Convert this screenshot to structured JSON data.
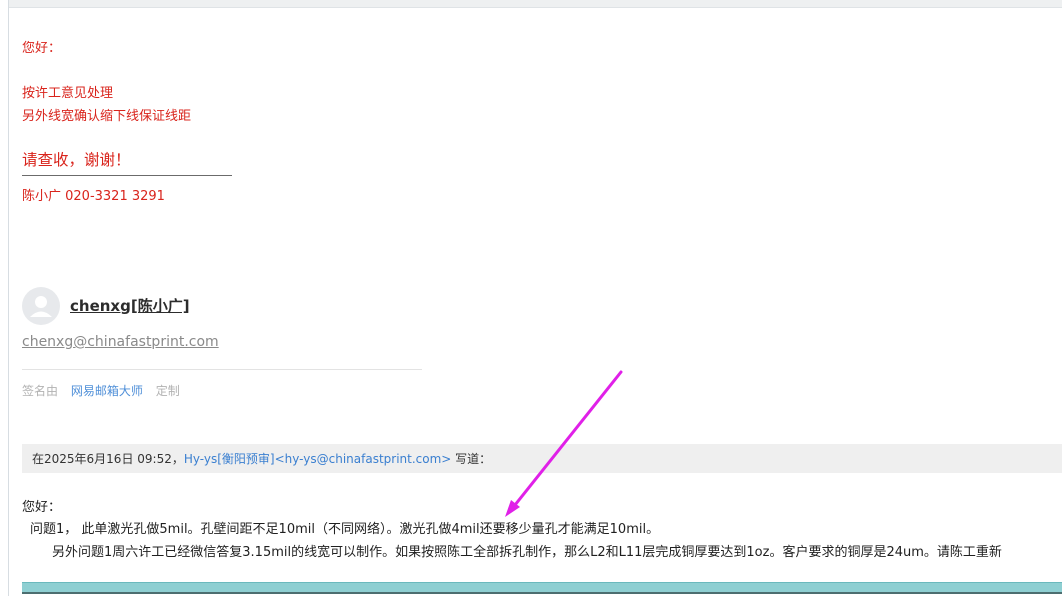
{
  "reply": {
    "greeting": "您好：",
    "line1": "按许工意见处理",
    "line2": "另外线宽确认缩下线保证线距",
    "thanks": "请查收，谢谢！",
    "contact": "陈小广 020-3321 3291",
    "text_color": "#d9241c"
  },
  "signature_card": {
    "avatar_icon": "user-avatar-icon",
    "name": "chenxg[陈小广]",
    "email": "chenxg@chinafastprint.com",
    "signed_by_label": "签名由",
    "tool_link": "网易邮箱大师",
    "customize_link": "定制"
  },
  "quote_header": {
    "prefix": "在2025年6月16日 09:52，",
    "sender": "Hy-ys[衡阳预审]<hy-ys@chinafastprint.com>",
    "suffix": " 写道："
  },
  "quoted_body": {
    "greeting": "您好：",
    "paragraph1": "问题1， 此单激光孔做5mil。孔壁间距不足10mil（不同网络）。激光孔做4mil还要移少量孔才能满足10mil。",
    "paragraph2": "另外问题1周六许工已经微信答复3.15mil的线宽可以制作。如果按照陈工全部拆孔制作，那么L2和L11层完成铜厚要达到1oz。客户要求的铜厚是24um。请陈工重新"
  },
  "annotation": {
    "arrow_color": "#e020e8"
  },
  "colors": {
    "quote_header_bg": "#efefef",
    "bottom_bar": "#8ecfd2",
    "link": "#3a7fd0"
  }
}
